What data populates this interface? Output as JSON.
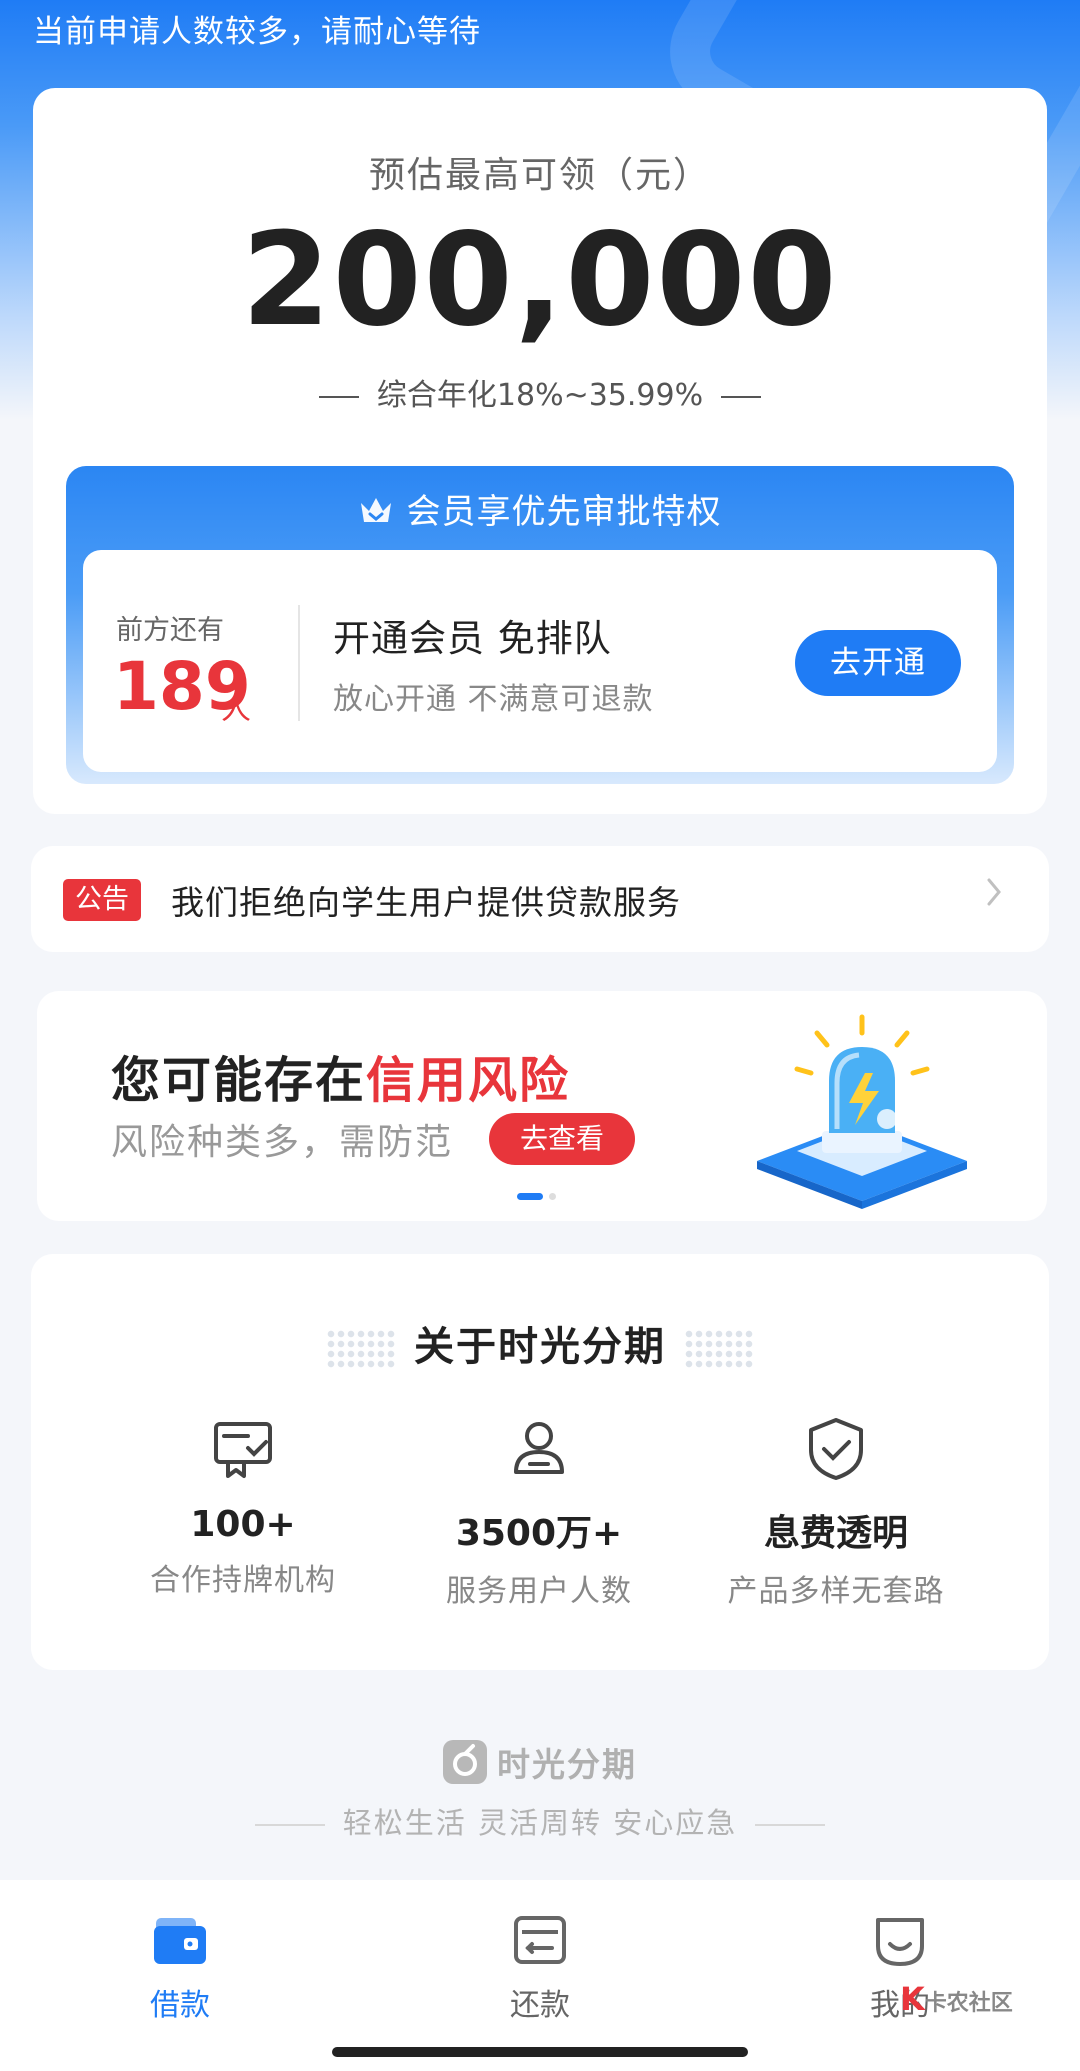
{
  "queue_notice": "当前申请人数较多，请耐心等待",
  "limit": {
    "label": "预估最高可领（元）",
    "amount": "200,000",
    "rate": "综合年化18%~35.99%"
  },
  "vip": {
    "header": "会员享优先审批特权",
    "queue_label": "前方还有",
    "queue_count": "189",
    "queue_unit": "人",
    "title": "开通会员 免排队",
    "subtitle": "放心开通 不满意可退款",
    "button": "去开通"
  },
  "notice": {
    "tag": "公告",
    "text": "我们拒绝向学生用户提供贷款服务"
  },
  "risk_banner": {
    "title_prefix": "您可能存在",
    "title_highlight": "信用风险",
    "subtitle": "风险种类多，需防范",
    "button": "去查看"
  },
  "about": {
    "title": "关于时光分期",
    "stats": [
      {
        "value": "100+",
        "label": "合作持牌机构",
        "icon": "license-icon"
      },
      {
        "value": "3500万+",
        "label": "服务用户人数",
        "icon": "user-icon"
      },
      {
        "value": "息费透明",
        "label": "产品多样无套路",
        "icon": "shield-check-icon"
      }
    ]
  },
  "brand": {
    "name": "时光分期",
    "slogan": "轻松生活 灵活周转 安心应急"
  },
  "tabbar": {
    "items": [
      {
        "label": "借款",
        "icon": "wallet-icon",
        "active": true
      },
      {
        "label": "还款",
        "icon": "card-icon",
        "active": false
      },
      {
        "label": "我的",
        "icon": "profile-face-icon",
        "active": false
      }
    ]
  },
  "watermark": "卡农社区",
  "colors": {
    "primary": "#1f7cf5",
    "danger": "#e8353b"
  }
}
